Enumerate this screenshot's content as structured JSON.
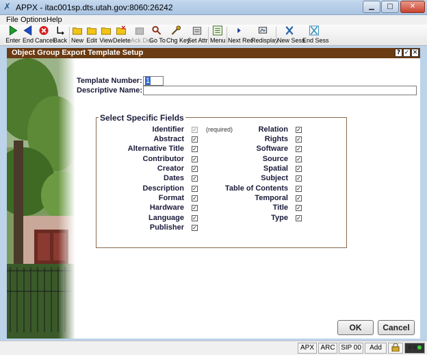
{
  "window": {
    "title": "APPX - itac001sp.dts.utah.gov:8060:26242"
  },
  "menu": [
    "File",
    "Options",
    "Help"
  ],
  "toolbar": [
    {
      "label": "Enter",
      "icon": "enter-icon"
    },
    {
      "label": "End",
      "icon": "end-icon"
    },
    {
      "label": "Cancel",
      "icon": "cancel-icon"
    },
    {
      "label": "Back",
      "icon": "back-icon"
    },
    {
      "label": "New",
      "icon": "folder-new-icon"
    },
    {
      "label": "Edit",
      "icon": "folder-edit-icon"
    },
    {
      "label": "View",
      "icon": "folder-view-icon"
    },
    {
      "label": "Delete",
      "icon": "folder-delete-icon"
    },
    {
      "label": "Ack Del",
      "icon": "ack-del-icon",
      "disabled": true
    },
    {
      "label": "Go To",
      "icon": "magnifier-icon"
    },
    {
      "label": "Chg Key",
      "icon": "key-icon"
    },
    {
      "label": "Set Attr",
      "icon": "set-attr-icon"
    },
    {
      "label": "Menu",
      "icon": "menu-icon"
    },
    {
      "label": "Next Rec",
      "icon": "next-rec-icon"
    },
    {
      "label": "Redisplay",
      "icon": "redisplay-icon"
    },
    {
      "label": "New Sess",
      "icon": "new-session-icon"
    },
    {
      "label": "End Sess",
      "icon": "end-session-icon"
    }
  ],
  "form": {
    "title": "Object Group Export Template Setup",
    "header_buttons": [
      "?",
      "✓",
      "✕"
    ],
    "template_number_label": "Template Number:",
    "template_number_value": "1",
    "descriptive_name_label": "Descriptive Name:",
    "descriptive_name_value": "",
    "fields_group_title": "Select Specific Fields",
    "required_note": "(required)",
    "left_fields": [
      {
        "label": "Identifier",
        "checked": true,
        "disabled": true
      },
      {
        "label": "Abstract",
        "checked": true
      },
      {
        "label": "Alternative Title",
        "checked": true
      },
      {
        "label": "Contributor",
        "checked": true
      },
      {
        "label": "Creator",
        "checked": true
      },
      {
        "label": "Dates",
        "checked": true
      },
      {
        "label": "Description",
        "checked": true
      },
      {
        "label": "Format",
        "checked": true
      },
      {
        "label": "Hardware",
        "checked": true
      },
      {
        "label": "Language",
        "checked": true
      },
      {
        "label": "Publisher",
        "checked": true
      }
    ],
    "right_fields": [
      {
        "label": "Relation",
        "checked": true
      },
      {
        "label": "Rights",
        "checked": true
      },
      {
        "label": "Software",
        "checked": true
      },
      {
        "label": "Source",
        "checked": true
      },
      {
        "label": "Spatial",
        "checked": true
      },
      {
        "label": "Subject",
        "checked": true
      },
      {
        "label": "Table of Contents",
        "checked": true
      },
      {
        "label": "Temporal",
        "checked": true
      },
      {
        "label": "Title",
        "checked": true
      },
      {
        "label": "Type",
        "checked": true
      }
    ],
    "ok_label": "OK",
    "cancel_label": "Cancel"
  },
  "status": {
    "cells": [
      "APX",
      "ARC",
      "SIP 00",
      "Add"
    ]
  },
  "colors": {
    "form_header": "#6b3b13",
    "fieldset_border": "#8b6a4e",
    "label_text": "#1a1a3a"
  }
}
